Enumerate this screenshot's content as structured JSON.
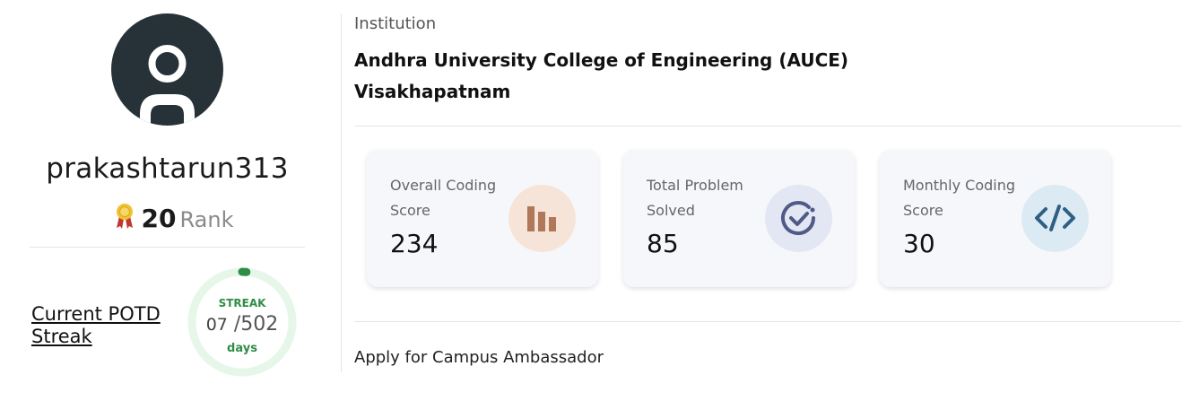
{
  "profile": {
    "username": "prakashtarun313",
    "rank_value": "20",
    "rank_label": "Rank",
    "avatar_icon": "user-icon",
    "medal_icon": "medal-icon"
  },
  "potd": {
    "link_label": "Current POTD Streak",
    "streak_title": "STREAK",
    "current": "07",
    "total": "/502",
    "unit": "days",
    "progress_fraction": 0.014,
    "ring_color": "#e6f7e9",
    "progress_color": "#2f8d46"
  },
  "institution": {
    "label": "Institution",
    "name_line1": "Andhra University College of Engineering (AUCE)",
    "name_line2": "Visakhapatnam"
  },
  "stats": [
    {
      "title": "Overall Coding Score",
      "value": "234",
      "icon": "bar-chart-icon",
      "icon_bg": "#f7e4d8",
      "icon_color": "#b0775a"
    },
    {
      "title": "Total Problem Solved",
      "value": "85",
      "icon": "check-circle-icon",
      "icon_bg": "#e3e6f3",
      "icon_color": "#4f5a86"
    },
    {
      "title": "Monthly Coding Score",
      "value": "30",
      "icon": "code-icon",
      "icon_bg": "#dcebf3",
      "icon_color": "#2f5f83"
    }
  ],
  "footer": {
    "ambassador_label": "Apply for Campus Ambassador"
  }
}
